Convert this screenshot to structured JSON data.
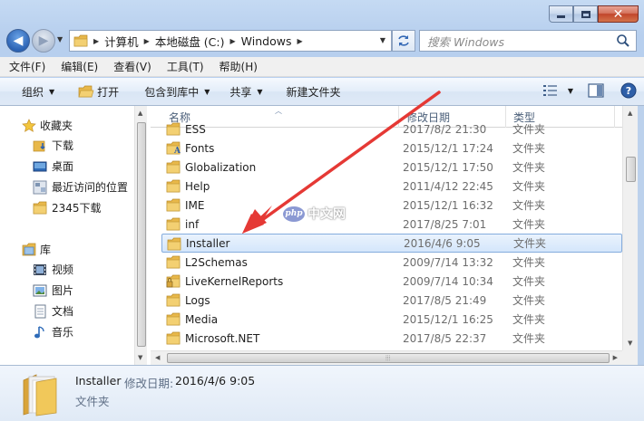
{
  "window": {
    "caption": {
      "minimize": "minimize-icon",
      "maximize": "maximize-icon",
      "close": "✕"
    }
  },
  "nav": {
    "back_icon": "◀",
    "forward_icon": "▶",
    "breadcrumb": [
      "计算机",
      "本地磁盘 (C:)",
      "Windows"
    ],
    "search_placeholder": "搜索 Windows"
  },
  "menubar": [
    "文件(F)",
    "编辑(E)",
    "查看(V)",
    "工具(T)",
    "帮助(H)"
  ],
  "toolbar": {
    "organize": "组织",
    "open": "打开",
    "include_in_library": "包含到库中",
    "share": "共享",
    "new_folder": "新建文件夹"
  },
  "sidebar": {
    "favorites": {
      "label": "收藏夹",
      "items": [
        "下载",
        "桌面",
        "最近访问的位置",
        "2345下载"
      ]
    },
    "libraries": {
      "label": "库",
      "items": [
        "视频",
        "图片",
        "文档",
        "音乐"
      ]
    }
  },
  "columns": {
    "name": "名称",
    "date": "修改日期",
    "type": "类型"
  },
  "files": [
    {
      "name": "ESS",
      "date": "2017/8/2 21:30",
      "type": "文件夹"
    },
    {
      "name": "Fonts",
      "date": "2015/12/1 17:24",
      "type": "文件夹"
    },
    {
      "name": "Globalization",
      "date": "2015/12/1 17:50",
      "type": "文件夹"
    },
    {
      "name": "Help",
      "date": "2011/4/12 22:45",
      "type": "文件夹"
    },
    {
      "name": "IME",
      "date": "2015/12/1 16:32",
      "type": "文件夹"
    },
    {
      "name": "inf",
      "date": "2017/8/25 7:01",
      "type": "文件夹"
    },
    {
      "name": "Installer",
      "date": "2016/4/6 9:05",
      "type": "文件夹"
    },
    {
      "name": "L2Schemas",
      "date": "2009/7/14 13:32",
      "type": "文件夹"
    },
    {
      "name": "LiveKernelReports",
      "date": "2009/7/14 10:34",
      "type": "文件夹"
    },
    {
      "name": "Logs",
      "date": "2017/8/5 21:49",
      "type": "文件夹"
    },
    {
      "name": "Media",
      "date": "2015/12/1 16:25",
      "type": "文件夹"
    },
    {
      "name": "Microsoft.NET",
      "date": "2017/8/5 22:37",
      "type": "文件夹"
    }
  ],
  "details": {
    "name": "Installer",
    "modified_label": "修改日期:",
    "modified_value": "2016/4/6 9:05",
    "type": "文件夹"
  },
  "watermark": {
    "badge": "php",
    "text": "中文网"
  },
  "colors": {
    "accent": "#3469b5",
    "selection": "#d4e6fb",
    "annotation_arrow": "#e53935",
    "folder": "#e8b84a"
  }
}
